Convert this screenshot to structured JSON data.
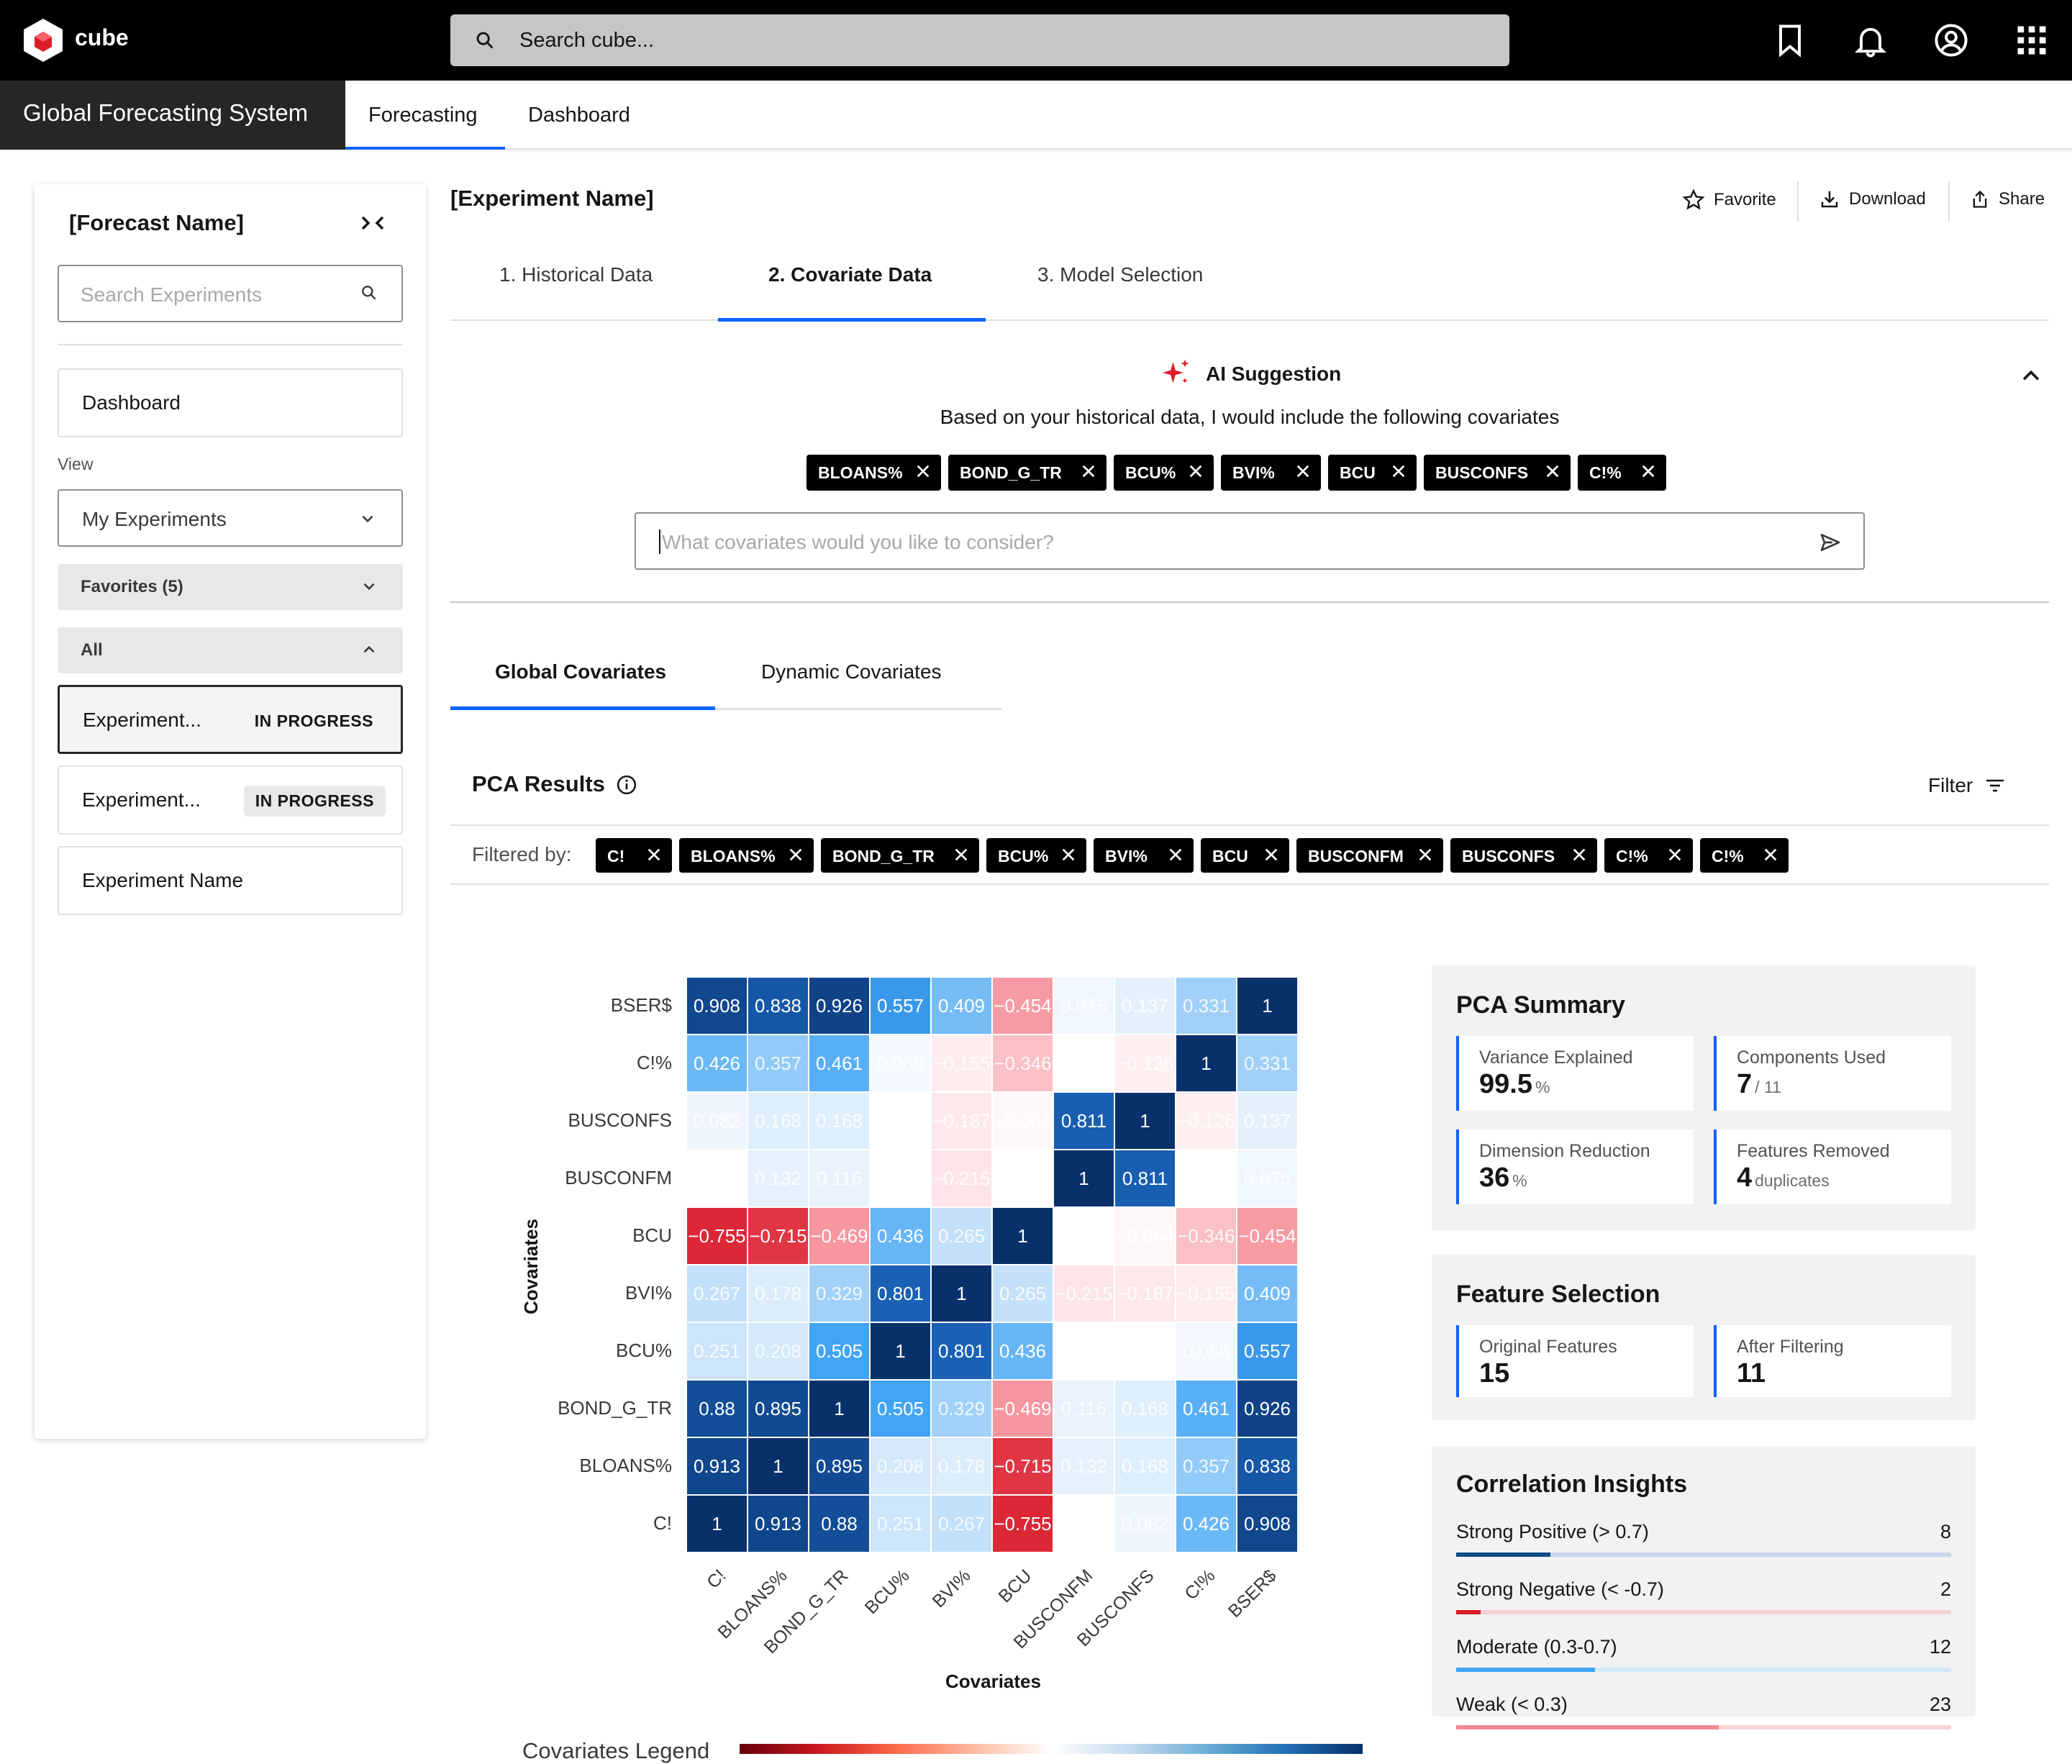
{
  "app": {
    "name": "cube",
    "search_placeholder": "Search cube..."
  },
  "system": {
    "title": "Global Forecasting System"
  },
  "nav": {
    "forecasting": "Forecasting",
    "dashboard": "Dashboard"
  },
  "sidebar": {
    "title": "[Forecast Name]",
    "collapse": "><",
    "search_placeholder": "Search Experiments",
    "dashboard": "Dashboard",
    "view_label": "View",
    "view_value": "My Experiments",
    "favorites": "Favorites (5)",
    "all": "All",
    "experiments": [
      {
        "name": "Experiment...",
        "status": "IN PROGRESS"
      },
      {
        "name": "Experiment...",
        "status": "IN PROGRESS"
      },
      {
        "name": "Experiment Name",
        "status": ""
      }
    ]
  },
  "header": {
    "title": "[Experiment Name]",
    "favorite": "Favorite",
    "download": "Download",
    "share": "Share"
  },
  "steps": [
    "1. Historical Data",
    "2. Covariate Data",
    "3. Model Selection"
  ],
  "ai": {
    "title": "AI Suggestion",
    "subtitle": "Based on your historical data, I would include the following covariates",
    "chips": [
      "BLOANS%",
      "BOND_G_TR",
      "BCU%",
      "BVI%",
      "BCU",
      "BUSCONFS",
      "C!%"
    ],
    "input_placeholder": "What covariates would you like to consider?"
  },
  "cov_tabs": {
    "global": "Global Covariates",
    "dynamic": "Dynamic Covariates"
  },
  "pca": {
    "title": "PCA Results",
    "filter": "Filter",
    "filtered_by": "Filtered by:",
    "filter_chips": [
      "C!",
      "BLOANS%",
      "BOND_G_TR",
      "BCU%",
      "BVI%",
      "BCU",
      "BUSCONFM",
      "BUSCONFS",
      "C!%",
      "C!%"
    ]
  },
  "chart_data": {
    "type": "heatmap",
    "xlabel": "Covariates",
    "ylabel": "Covariates",
    "columns": [
      "C!",
      "BLOANS%",
      "BOND_G_TR",
      "BCU%",
      "BVI%",
      "BCU",
      "BUSCONFM",
      "BUSCONFS",
      "C!%",
      "BSER$"
    ],
    "rows": [
      "BSER$",
      "C!%",
      "BUSCONFS",
      "BUSCONFM",
      "BCU",
      "BVI%",
      "BCU%",
      "BOND_G_TR",
      "BLOANS%",
      "C!"
    ],
    "values": [
      [
        0.908,
        0.838,
        0.926,
        0.557,
        0.409,
        -0.454,
        0.075,
        0.137,
        0.331,
        1
      ],
      [
        0.426,
        0.357,
        0.461,
        0.066,
        -0.155,
        -0.346,
        null,
        -0.126,
        1,
        0.331
      ],
      [
        0.082,
        0.168,
        0.168,
        null,
        -0.187,
        -0.064,
        0.811,
        1,
        -0.126,
        0.137
      ],
      [
        null,
        0.132,
        0.116,
        null,
        -0.215,
        null,
        1,
        0.811,
        null,
        0.075
      ],
      [
        -0.755,
        -0.715,
        -0.469,
        0.436,
        0.265,
        1,
        null,
        -0.064,
        -0.346,
        -0.454
      ],
      [
        0.267,
        0.178,
        0.329,
        0.801,
        1,
        0.265,
        -0.215,
        -0.187,
        -0.155,
        0.409
      ],
      [
        0.251,
        0.208,
        0.505,
        1,
        0.801,
        0.436,
        null,
        null,
        0.066,
        0.557
      ],
      [
        0.88,
        0.895,
        1,
        0.505,
        0.329,
        -0.469,
        0.116,
        0.168,
        0.461,
        0.926
      ],
      [
        0.913,
        1,
        0.895,
        0.208,
        0.178,
        -0.715,
        0.132,
        0.168,
        0.357,
        0.838
      ],
      [
        1,
        0.913,
        0.88,
        0.251,
        0.267,
        -0.755,
        null,
        0.082,
        0.426,
        0.908
      ]
    ],
    "range": [
      -1,
      1
    ],
    "colormap": "red-white-blue",
    "legend_title": "Covariates Legend"
  },
  "pca_summary": {
    "title": "PCA Summary",
    "tiles": [
      {
        "label": "Variance Explained",
        "value": "99.5",
        "unit": "%"
      },
      {
        "label": "Components Used",
        "value": "7",
        "unit": "/ 11"
      },
      {
        "label": "Dimension Reduction",
        "value": "36",
        "unit": "%"
      },
      {
        "label": "Features Removed",
        "value": "4",
        "unit": "duplicates"
      }
    ]
  },
  "feature_selection": {
    "title": "Feature Selection",
    "tiles": [
      {
        "label": "Original Features",
        "value": "15"
      },
      {
        "label": "After Filtering",
        "value": "11"
      }
    ]
  },
  "correlation_insights": {
    "title": "Correlation Insights",
    "rows": [
      {
        "label": "Strong Positive (> 0.7)",
        "count": "8",
        "fraction": 0.19,
        "color": "#0f4c8a",
        "track": "#c6d8ea"
      },
      {
        "label": "Strong Negative (< -0.7)",
        "count": "2",
        "fraction": 0.05,
        "color": "#da1e28",
        "track": "#f6d2d5"
      },
      {
        "label": "Moderate (0.3-0.7)",
        "count": "12",
        "fraction": 0.28,
        "color": "#42a5f5",
        "track": "#d3e8fb"
      },
      {
        "label": "Weak (< 0.3)",
        "count": "23",
        "fraction": 0.53,
        "color": "#f28b95",
        "track": "#f9d3d7"
      }
    ]
  },
  "colors": {
    "accent": "#0f62fe",
    "ai_sparkle": "#da1e28"
  }
}
